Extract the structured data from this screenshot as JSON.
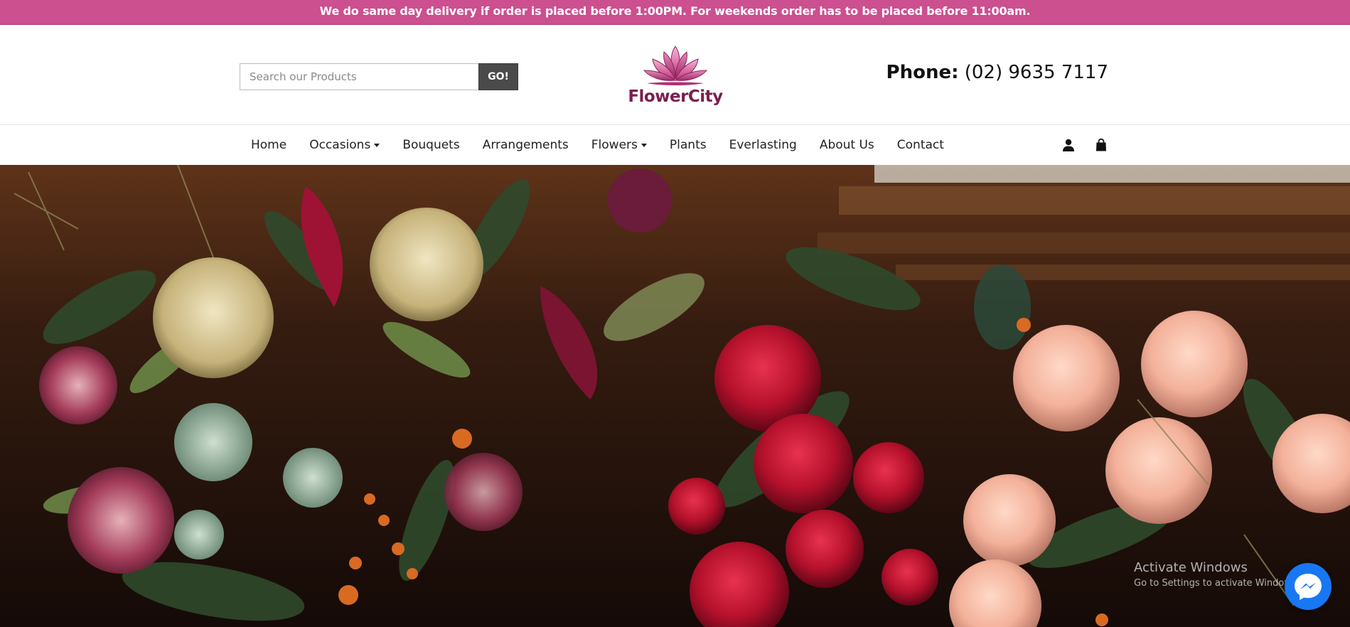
{
  "announcement": "We do same day delivery if order is placed before 1:00PM. For weekends order has to be placed before 11:00am.",
  "search": {
    "placeholder": "Search our Products",
    "button_label": "GO!"
  },
  "logo": {
    "text": "FlowerCity",
    "icon": "lotus-logo-icon"
  },
  "phone": {
    "label": "Phone:",
    "number": "(02) 9635 7117"
  },
  "nav": {
    "items": [
      {
        "label": "Home",
        "dropdown": false
      },
      {
        "label": "Occasions",
        "dropdown": true
      },
      {
        "label": "Bouquets",
        "dropdown": false
      },
      {
        "label": "Arrangements",
        "dropdown": false
      },
      {
        "label": "Flowers",
        "dropdown": true
      },
      {
        "label": "Plants",
        "dropdown": false
      },
      {
        "label": "Everlasting",
        "dropdown": false
      },
      {
        "label": "About Us",
        "dropdown": false
      },
      {
        "label": "Contact",
        "dropdown": false
      }
    ],
    "icons": [
      "user-icon",
      "shopping-bag-icon"
    ]
  },
  "hero": {
    "image": "flower-bouquets-hero-image"
  },
  "watermark": {
    "title": "Activate Windows",
    "subtitle": "Go to Settings to activate Windows."
  },
  "messenger": {
    "icon": "messenger-icon"
  },
  "colors": {
    "announcement_bg": "#cc4f8f",
    "go_button_bg": "#4a4a4a",
    "logo_text": "#7a1f4e",
    "messenger_bg": "#1877f2"
  }
}
